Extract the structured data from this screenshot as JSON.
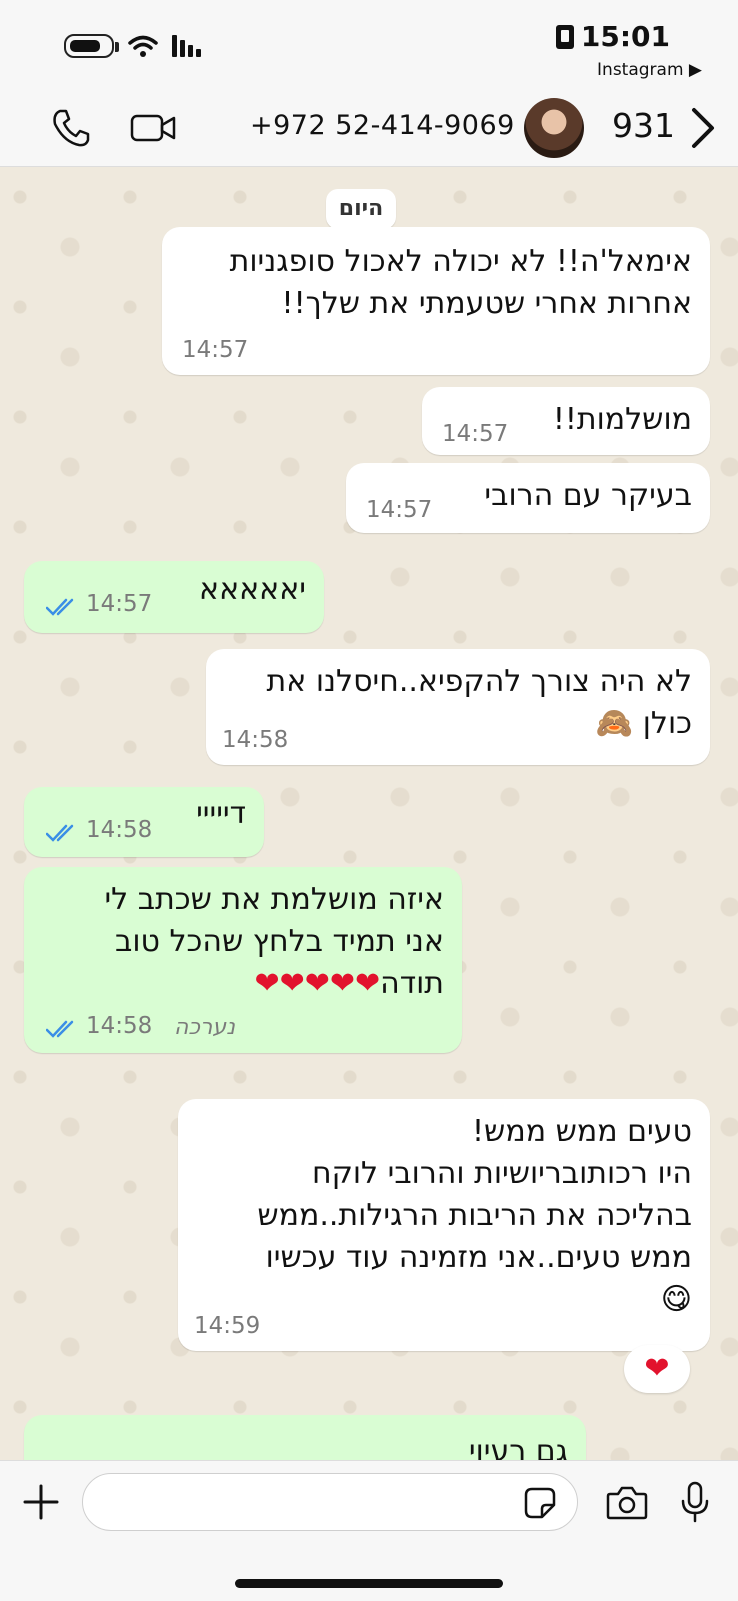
{
  "status": {
    "time": "15:01",
    "back_app": "Instagram ▶"
  },
  "header": {
    "phone": "+972 52-414-9069",
    "count": "931"
  },
  "chat": {
    "day_label": "היום",
    "messages": [
      {
        "dir": "in",
        "lines": [
          "אימאל'ה!! לא יכולה לאכול סופגניות",
          "אחרות אחרי שטעמתי את שלך!!"
        ],
        "time": "14:57"
      },
      {
        "dir": "in",
        "lines": [
          "מושלמות!!"
        ],
        "time": "14:57"
      },
      {
        "dir": "in",
        "lines": [
          "בעיקר עם הרובי"
        ],
        "time": "14:57"
      },
      {
        "dir": "out",
        "lines": [
          "יאאאאא"
        ],
        "time": "14:57"
      },
      {
        "dir": "in",
        "lines": [
          "לא היה צורך להקפיא..חיסלנו את",
          "כולן 🙈"
        ],
        "time": "14:58"
      },
      {
        "dir": "out",
        "lines": [
          "דייייי"
        ],
        "time": "14:58"
      },
      {
        "dir": "out",
        "lines": [
          "איזה מושלמת את שכתב לי",
          "אני תמיד בלחץ שהכל טוב",
          "תודה"
        ],
        "hearts": "❤❤❤❤❤",
        "time": "14:58",
        "edited": "נערכה"
      },
      {
        "dir": "in",
        "lines": [
          "טעים ממש ממש!",
          "היו רכותובריושיות והרובי לוקח",
          "בהליכה את הריבות הרגילות..ממש",
          "ממש טעים..אני מזמינה עוד עכשיו",
          "😋"
        ],
        "time": "14:59"
      },
      {
        "dir": "out",
        "lines": [
          "גם רעיוי"
        ]
      }
    ],
    "reaction": "❤"
  },
  "composer": {
    "placeholder": ""
  },
  "colors": {
    "incoming": "#ffffff",
    "outgoing": "#d9fdd3",
    "tick_read": "#3a8ee6"
  },
  "icons": [
    "battery-icon",
    "wifi-icon",
    "signal-icon",
    "sim-icon",
    "phone-icon",
    "video-icon",
    "chevron-right-icon",
    "plus-icon",
    "sticker-icon",
    "camera-icon",
    "mic-icon",
    "double-check-icon"
  ]
}
